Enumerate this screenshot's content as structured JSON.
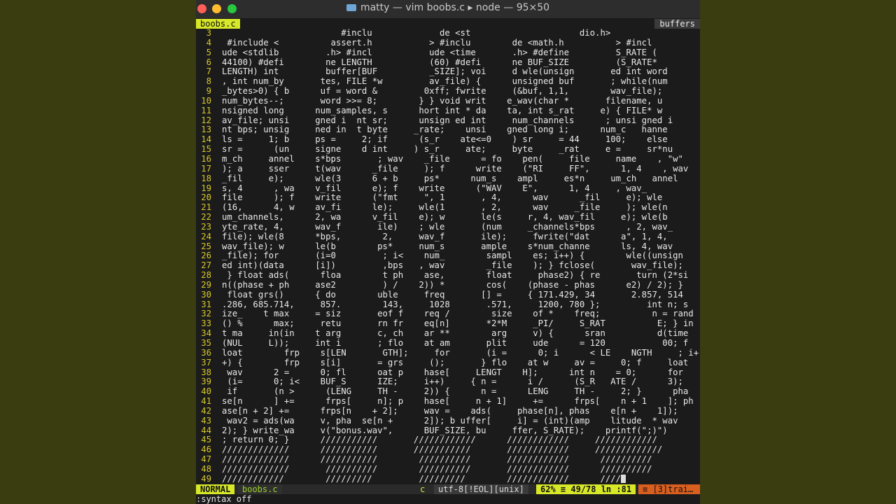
{
  "window": {
    "title": "matty — vim boobs.c ▸ node — 95×50"
  },
  "tabline": {
    "file_tab": "boobs.c",
    "buffers_label": "buffers"
  },
  "code_lines": [
    {
      "n": "3",
      "t": "                       #inclu             de <st                     dio.h>"
    },
    {
      "n": "4",
      "t": " #include <          assert.h           > #inclu        de <math.h          > #incl"
    },
    {
      "n": "5",
      "t": "ude <stdlib         .h> #incl           ude <time       .h> #define         S_RATE ("
    },
    {
      "n": "6",
      "t": "44100) #defi        ne LENGTH           (60) #defi      ne BUF_SIZE         (S_RATE*"
    },
    {
      "n": "7",
      "t": "LENGTH) int         buffer[BUF          _SIZE]; voi     d wle(unsign       ed int word"
    },
    {
      "n": "8",
      "t": ", int num_by       tes, FILE *w         av_file) {      unsigned buf       ; while(num"
    },
    {
      "n": "9",
      "t": "_bytes>0) { b      uf = word &         0xff; fwrite     (&buf, 1,1,        wav_file);"
    },
    {
      "n": "10",
      "t": "num_bytes--;       word >>= 8;        } } void writ    e_wav(char *       filename, u"
    },
    {
      "n": "11",
      "t": "nsigned long      num_samples, s      hort int * da    ta, int s_rat     e) { FILE* w"
    },
    {
      "n": "12",
      "t": "av_file; unsi     gned i  nt sr;      unsign ed int     num_channels      ; unsi gned i"
    },
    {
      "n": "13",
      "t": "nt bps; unsig     ned in  t byte     _rate;    unsi    gned long i;      num_c   hanne"
    },
    {
      "n": "14",
      "t": "ls =     1; b     ps =     2; if      (s_r    ate<=0    ) sr     = 44     100;    else"
    },
    {
      "n": "15",
      "t": "sr =      (un     signe    d int     ) s_r     ate;     byte     _rat     e =     sr*nu"
    },
    {
      "n": "16",
      "t": "m_ch     annel    s*bps       ; wav    _file      = fo    pen(     file     name    , \"w\""
    },
    {
      "n": "17",
      "t": "); a     sser     t(wav      _file     ); f      write    (\"RI     FF\",      1, 4    , wav"
    },
    {
      "n": "18",
      "t": "_fil     e);      wle(3      6 + b     ps*      num_s    ampl     es*n     um_ch   annel"
    },
    {
      "n": "19",
      "t": "s, 4      , wa    v_fil      e); f    write      (\"WAV    E\",      1, 4     , wav_"
    },
    {
      "n": "20",
      "t": "file      ); f    write      (\"fmt     \", 1       , 4,      wav      _fil     e); wle"
    },
    {
      "n": "21",
      "t": "(16,      4, w    av_fi      le);     wle(1       , 2,      wav     _file     ); wle(n"
    },
    {
      "n": "22",
      "t": "um_channels,      2, wa      v_fil    e); w       le(s     r, 4, wav_fil     e); wle(b"
    },
    {
      "n": "23",
      "t": "yte_rate, 4,      wav_f       ile)    ; wle       (num     _channels*bps      , 2, wav_"
    },
    {
      "n": "24",
      "t": "file); wle(8      *bps,        2,     wav_f       ile);     fwrite(\"dat      a\", 1, 4,"
    },
    {
      "n": "25",
      "t": "wav_file); w      le(b        ps*     num_s       ample    s*num_channe      ls, 4, wav"
    },
    {
      "n": "26",
      "t": "_file); for       (i=0         ; i<    num_        sampl    es; i++) {        wle((unsign"
    },
    {
      "n": "27",
      "t": "ed int)(data      [i])         ,bps   , wav        _file    ); } fclose(       wav_file);"
    },
    {
      "n": "28",
      "t": " } float ads(      floa        t ph    ase,        float     phase2) { re       turn (2*si"
    },
    {
      "n": "29",
      "t": "n((phase + ph     ase2         ) /    2)) *        cos(    (phase - phas      e2) / 2); }"
    },
    {
      "n": "30",
      "t": " float grs()      { do        uble     freq       [] =     { 171.429, 34       2.857, 514"
    },
    {
      "n": "31",
      "t": ".286, 685.714,     857.        143,     1028       .571,     1200, 780 };         int n; s"
    },
    {
      "n": "32",
      "t": "ize_    t max     = siz       eof f    req /        size    of *    freq;          n = rand"
    },
    {
      "n": "33",
      "t": "() %      max;     retu       rn fr    eq[n]       *2*M     _PI/     S_RAT          E; } in"
    },
    {
      "n": "34",
      "t": "t ma     in(in    t arg       c, ch    ar **        arg     v) {      sran          d(time"
    },
    {
      "n": "35",
      "t": "(NUL     L));     int i       ; flo    at am       plit     ude      = 120           00; f"
    },
    {
      "n": "36",
      "t": "loat        frp    s[LEN       GTH];     for       (i =      0; i      < LE    NGTH     ; i+"
    },
    {
      "n": "37",
      "t": "+) {        frp    s[i]       = grs     ();       } flo    at w     av =     0; f     loat"
    },
    {
      "n": "38",
      "t": " wav      2 =      0; fl      oat p    hase[     LENGT    H];      int n    = 0;      for"
    },
    {
      "n": "39",
      "t": " (i=      0; i<    BUF_S      IZE;     i++)     { n =      i /      (S_R   ATE /      3);"
    },
    {
      "n": "40",
      "t": " if       (n >      (LENG     TH -     2)) {      n =      LENG     TH -     2; }      pha"
    },
    {
      "n": "41",
      "t": "se[n      ] +=      frps[     n]; p    hase[     n + 1]     +=      frps[    n + 1    ]; ph"
    },
    {
      "n": "42",
      "t": "ase[n + 2] +=      frps[n    + 2];     wav =    ads(     phase[n], phas    e[n +    1]);"
    },
    {
      "n": "43",
      "t": " wav2 = ads(wa     v, pha  se[n +      2]); b uffer[     i] = (int)(amp    litude  * wav"
    },
    {
      "n": "44",
      "t": "2); } write_wa     v(\"bonus.wav\",      BUF_SIZE, bu     ffer, S_RATE);    printf(\";)\")"
    },
    {
      "n": "45",
      "t": "; return 0; }      ///////////       ////////////      ////////////     ////////////"
    },
    {
      "n": "46",
      "t": "/////////////      ///////////       ///////////       ////////////     /////////////"
    },
    {
      "n": "47",
      "t": "/////////////      ///////////        //////////       ////////////      //////////"
    },
    {
      "n": "48",
      "t": "/////////////       //////////        //////////       ////////////      //////////"
    },
    {
      "n": "49",
      "t": "////////////        /////////         /////////        ////////////      ////"
    }
  ],
  "last_line_tail": "////",
  "statusline": {
    "mode": "NORMAL",
    "filename": "boobs.c",
    "filetype": "c",
    "encoding": "utf-8[!EOL][unix]",
    "position": "62% ≡ 49/78  ln :81",
    "trailing": "≡ [3]trai…"
  },
  "cmdline": {
    "text": ":syntax off"
  }
}
